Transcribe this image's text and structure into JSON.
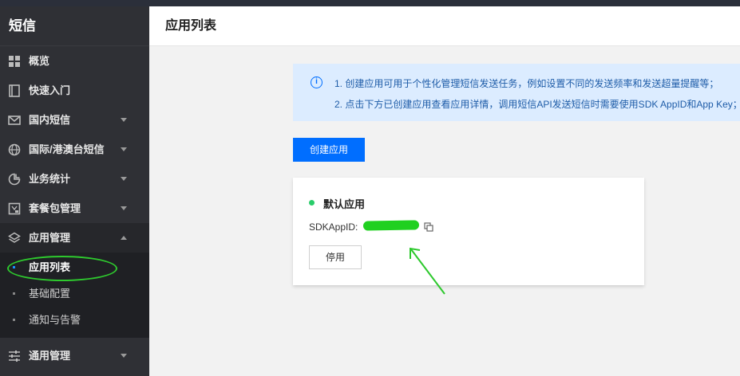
{
  "sidebar": {
    "title": "短信",
    "items": [
      {
        "label": "概览",
        "icon": "grid-icon"
      },
      {
        "label": "快速入门",
        "icon": "book-icon"
      },
      {
        "label": "国内短信",
        "icon": "mail-icon"
      },
      {
        "label": "国际/港澳台短信",
        "icon": "globe-icon"
      },
      {
        "label": "业务统计",
        "icon": "pie-chart-icon"
      },
      {
        "label": "套餐包管理",
        "icon": "package-icon"
      },
      {
        "label": "应用管理",
        "icon": "layers-icon"
      }
    ],
    "sub_items": [
      {
        "label": "应用列表"
      },
      {
        "label": "基础配置"
      },
      {
        "label": "通知与告警"
      }
    ],
    "bottom_item": {
      "label": "通用管理",
      "icon": "sliders-icon"
    }
  },
  "header": {
    "title": "应用列表"
  },
  "notice": {
    "line1": "1. 创建应用可用于个性化管理短信发送任务，例如设置不同的发送频率和发送超量提醒等；",
    "line2": "2. 点击下方已创建应用查看应用详情，调用短信API发送短信时需要使用SDK AppID和App Key；"
  },
  "create_button": {
    "label": "创建应用"
  },
  "app_card": {
    "name": "默认应用",
    "sdk_label": "SDKAppID:",
    "disable_label": "停用"
  },
  "colors": {
    "primary": "#006eff",
    "sidebar_bg": "#2f3035",
    "notice_bg": "#dcecff",
    "status_green": "#29cc6a",
    "annotation_green": "#2ec92e"
  }
}
